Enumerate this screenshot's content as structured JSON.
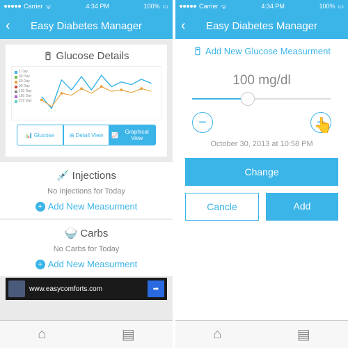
{
  "status": {
    "carrier": "Carrier",
    "time": "4:34 PM",
    "battery": "100%"
  },
  "nav": {
    "title": "Easy Diabetes Manager"
  },
  "left": {
    "glucose_title": "Glucose Details",
    "legend": [
      "1 Day",
      "30 Day",
      "60 Day",
      "90 Day",
      "120 Day",
      "180 Day",
      "210 Day"
    ],
    "seg": {
      "glucose": "Glucose",
      "detail": "Detail View",
      "graphical": "Graphical View"
    },
    "injections": {
      "title": "Injections",
      "empty": "No Injections for Today",
      "add": "Add New Measurment"
    },
    "carbs": {
      "title": "Carbs",
      "empty": "No Carbs for Today",
      "add": "Add New Measurment"
    },
    "ad": {
      "url": "www.easycomforts.com"
    }
  },
  "right": {
    "title": "Add New Glucose Measurment",
    "value": "100 mg/dl",
    "datetime": "October 30, 2013 at  10:58 PM",
    "change": "Change",
    "cancel": "Cancle",
    "add": "Add"
  },
  "chart_data": {
    "type": "line",
    "x": [
      1,
      2,
      3,
      4,
      5,
      6,
      7,
      8,
      9,
      10,
      11,
      12
    ],
    "series": [
      {
        "name": "1 Day",
        "color": "#3bb4e8",
        "values": [
          50,
          20,
          80,
          60,
          90,
          60,
          95,
          70,
          80,
          75,
          85,
          78
        ]
      },
      {
        "name": "60 Day",
        "color": "#e8a23b",
        "values": [
          45,
          25,
          55,
          50,
          65,
          55,
          70,
          60,
          62,
          58,
          65,
          60
        ]
      }
    ],
    "ylim": [
      0,
      100
    ]
  }
}
